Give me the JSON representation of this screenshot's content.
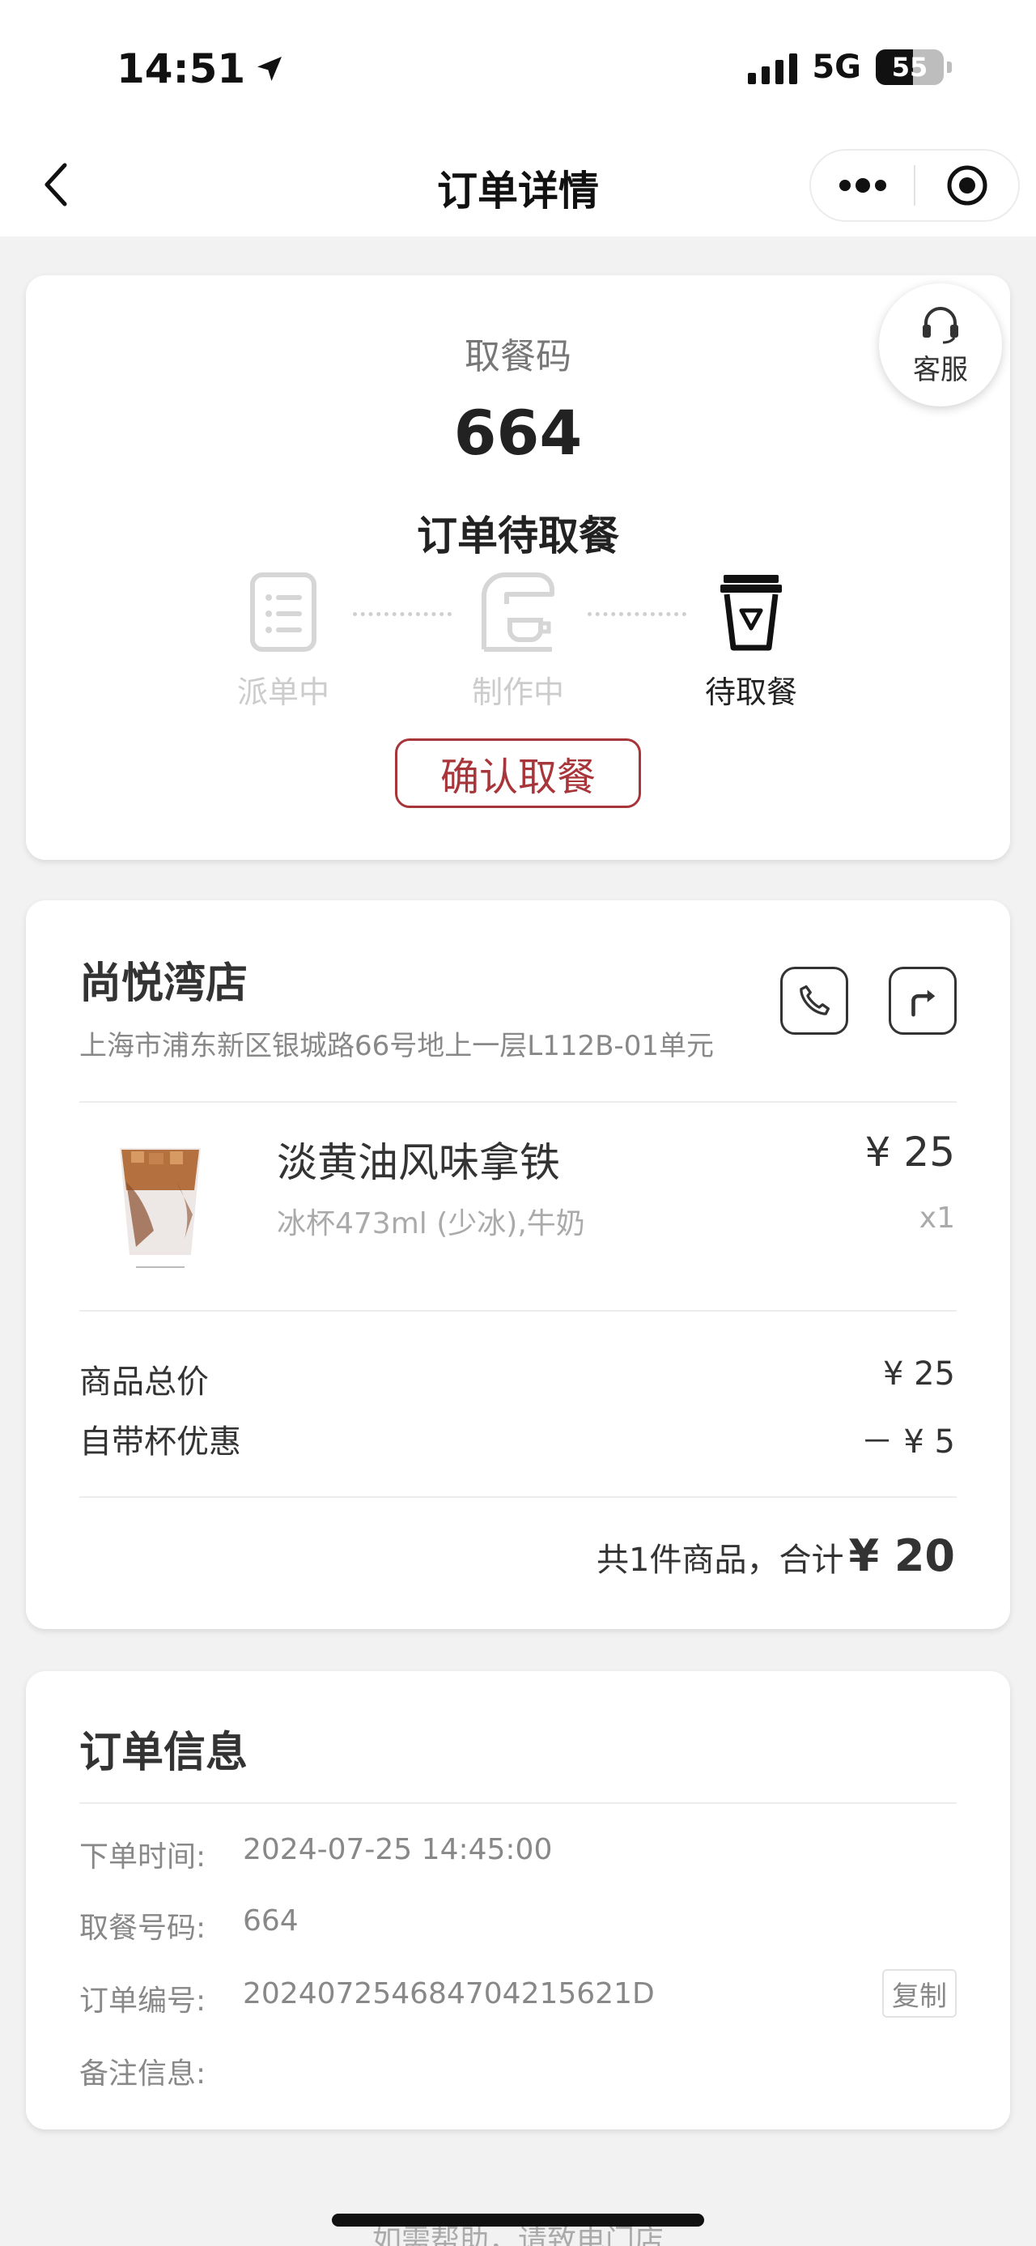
{
  "status_bar": {
    "time": "14:51",
    "network": "5G",
    "battery": "55",
    "battery_level": 0.55
  },
  "nav": {
    "title": "订单详情"
  },
  "pickup": {
    "service_label": "客服",
    "code_label": "取餐码",
    "code": "664",
    "status_title": "订单待取餐",
    "steps": [
      {
        "label": "派单中",
        "active": false
      },
      {
        "label": "制作中",
        "active": false
      },
      {
        "label": "待取餐",
        "active": true
      }
    ],
    "confirm_label": "确认取餐"
  },
  "store": {
    "name": "尚悦湾店",
    "address": "上海市浦东新区银城路66号地上一层L112B-01单元",
    "item": {
      "name": "淡黄油风味拿铁",
      "spec": "冰杯473ml (少冰),牛奶",
      "price": "¥ 25",
      "qty": "x1"
    },
    "summary": {
      "subtotal_label": "商品总价",
      "subtotal": "¥ 25",
      "discount_label": "自带杯优惠",
      "discount": "－ ¥ 5",
      "total_text": "共1件商品，合计",
      "total": "¥ 20"
    }
  },
  "order_info": {
    "title": "订单信息",
    "order_time_label": "下单时间:",
    "order_time": "2024-07-25 14:45:00",
    "pickup_no_label": "取餐号码:",
    "pickup_no": "664",
    "order_no_label": "订单编号:",
    "order_no": "20240725468470421562​1D",
    "copy_label": "复制",
    "remark_label": "备注信息:"
  },
  "footer": {
    "help_text": "如需帮助，请致电门店"
  },
  "colors": {
    "accent": "#a8353a",
    "background": "#f2f2f2"
  }
}
